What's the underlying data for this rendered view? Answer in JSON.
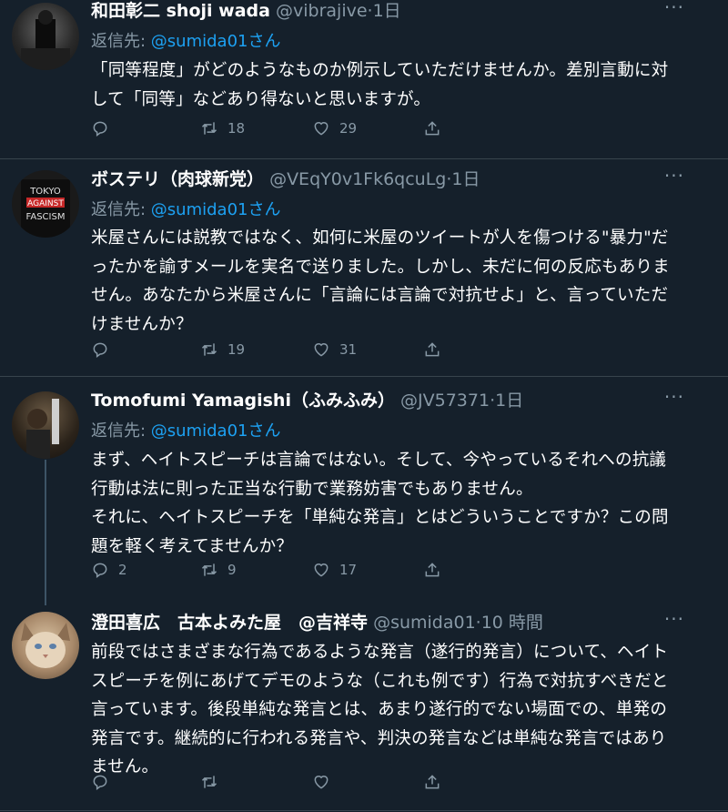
{
  "colors": {
    "background": "#15202b",
    "text": "#ffffff",
    "muted": "#8899a6",
    "link": "#1da1f2",
    "divider": "#38444d"
  },
  "tweets": [
    {
      "name": "和田彰二 shoji wada",
      "handle": "@vibrajive",
      "time": "·1日",
      "more": "···",
      "reply_prefix": "返信先: ",
      "reply_mention": "@sumida01さん",
      "lines": [
        "「同等程度」がどのようなものか例示していただけませんか。差別言動に対",
        "して「同等」などあり得ないと思いますが。"
      ],
      "replies": "",
      "retweets": "18",
      "likes": "29"
    },
    {
      "name": "ボステリ（肉球新党）",
      "handle": "@VEqY0v1Fk6qcuLg",
      "time": "·1日",
      "more": "···",
      "reply_prefix": "返信先: ",
      "reply_mention": "@sumida01さん",
      "lines": [
        "米屋さんには説教ではなく、如何に米屋のツイートが人を傷つける\"暴力\"だ",
        "ったかを諭すメールを実名で送りました。しかし、未だに何の反応もありま",
        "せん。あなたから米屋さんに「言論には言論で対抗せよ」と、言っていただ",
        "けませんか？"
      ],
      "replies": "",
      "retweets": "19",
      "likes": "31"
    },
    {
      "name": "Tomofumi Yamagishi（ふみふみ）",
      "handle": "@JV57371",
      "time": "·1日",
      "more": "···",
      "reply_prefix": "返信先: ",
      "reply_mention": "@sumida01さん",
      "lines": [
        "まず、ヘイトスピーチは言論ではない。そして、今やっているそれへの抗議",
        "行動は法に則った正当な行動で業務妨害でもありません。",
        "それに、ヘイトスピーチを「単純な発言」とはどういうことですか？この問",
        "題を軽く考えてませんか？"
      ],
      "replies": "2",
      "retweets": "9",
      "likes": "17"
    },
    {
      "name": "澄田喜広　古本よみた屋　@吉祥寺",
      "handle": "@sumida01",
      "time": "·10 時間",
      "more": "···",
      "lines": [
        "前段ではさまざまな行為であるような発言（遂行的発言）について、ヘイト",
        "スピーチを例にあげてデモのような（これも例です）行為で対抗すべきだと",
        "言っています。後段単純な発言とは、あまり遂行的でない場面での、単発の",
        "発言です。継続的に行われる発言や、判決の発言などは単純な発言ではあり",
        "ません。"
      ],
      "replies": "",
      "retweets": "",
      "likes": ""
    }
  ]
}
